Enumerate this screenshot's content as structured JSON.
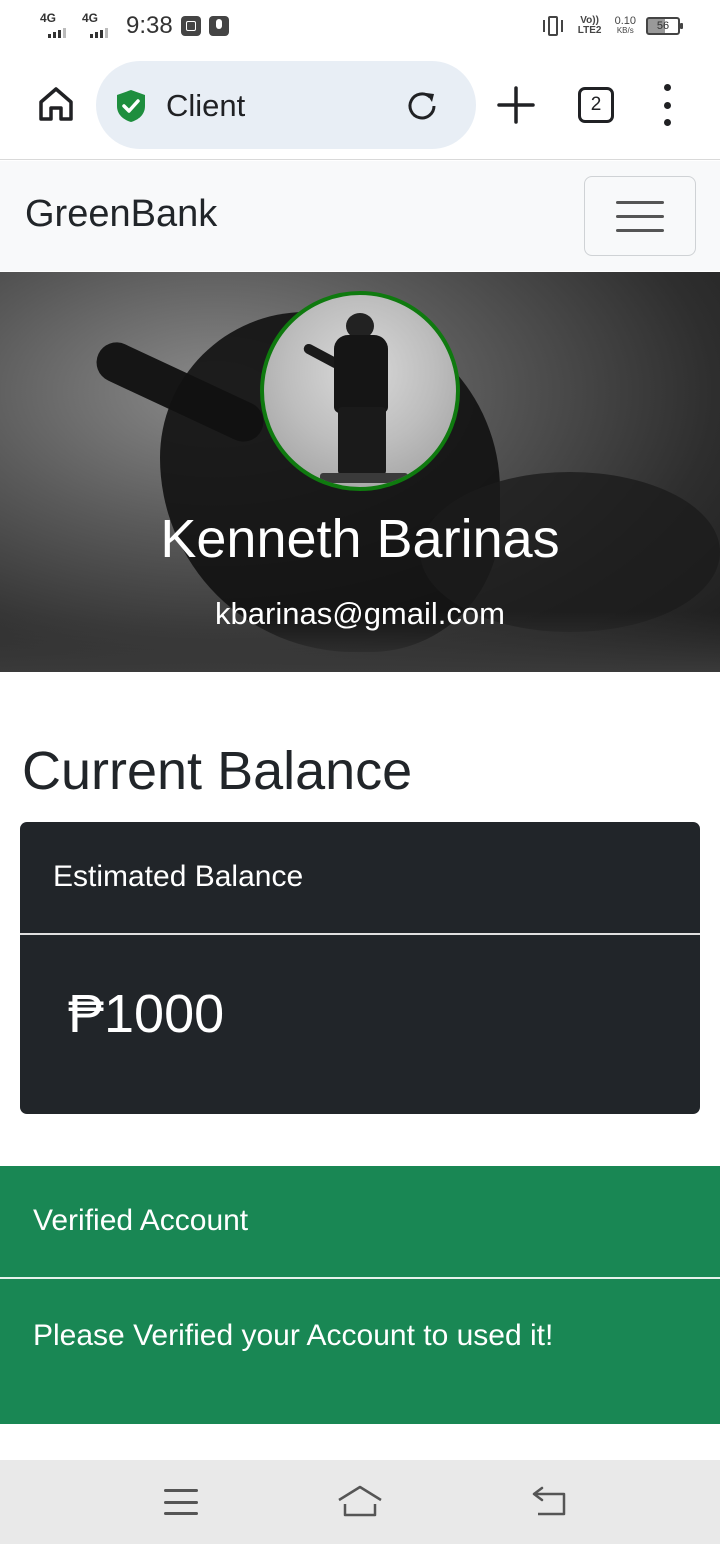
{
  "status_bar": {
    "sim1_network": "4G",
    "sim2_network": "4G",
    "time": "9:38",
    "volte_label": "Vo)) LTE2",
    "speed_value": "0.10",
    "speed_unit": "KB/s",
    "battery_level": "56"
  },
  "browser": {
    "url_text": "Client",
    "tab_count": "2"
  },
  "navbar": {
    "brand": "GreenBank"
  },
  "profile": {
    "name": "Kenneth Barinas",
    "email": "kbarinas@gmail.com"
  },
  "balance": {
    "section_title": "Current Balance",
    "card_header": "Estimated Balance",
    "amount": "₱1000"
  },
  "alert": {
    "heading": "Verified Account",
    "message": "Please Verified your Account to used it!"
  },
  "colors": {
    "brand_green": "#198754",
    "dark_card": "#212529",
    "avatar_border": "#0f7a0f"
  },
  "icons": {
    "home": "home-icon",
    "secure": "shield-check-icon",
    "reload": "reload-icon",
    "new_tab": "plus-icon",
    "menu": "more-vert-icon",
    "hamburger": "hamburger-icon",
    "sys_menu": "menu-icon",
    "sys_home": "home-outline-icon",
    "sys_back": "back-icon"
  }
}
